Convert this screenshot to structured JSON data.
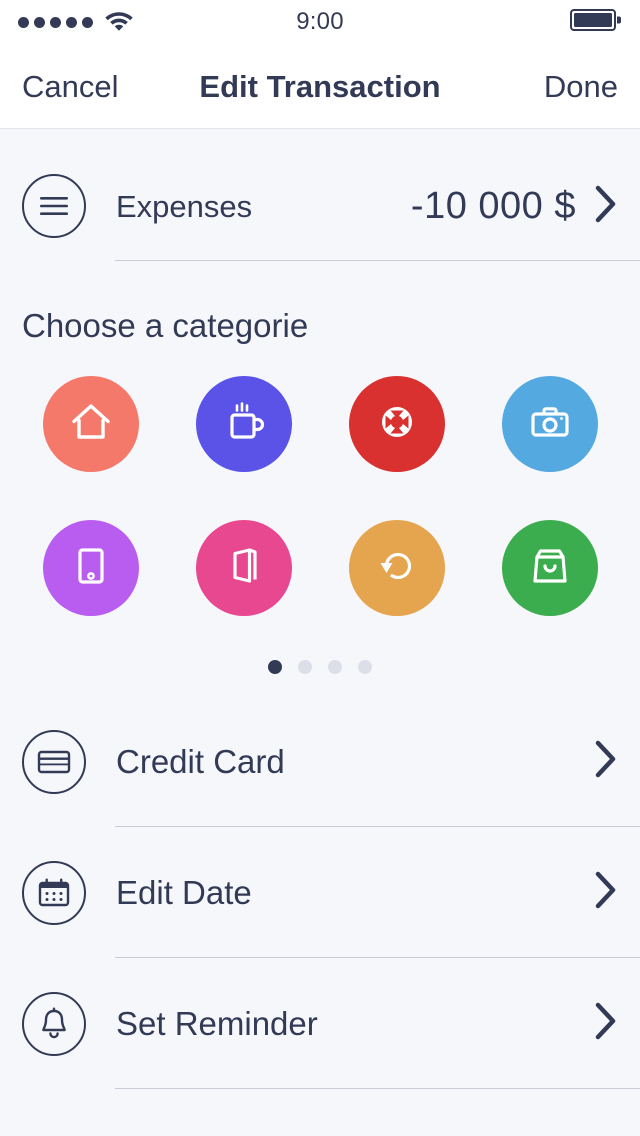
{
  "status_bar": {
    "signal_dots": 5,
    "wifi_icon": "wifi-icon",
    "time": "9:00",
    "battery_icon": "battery-full-icon"
  },
  "nav": {
    "cancel_label": "Cancel",
    "title": "Edit Transaction",
    "done_label": "Done"
  },
  "account_row": {
    "icon": "menu-lines-icon",
    "label": "Expenses",
    "amount": "-10 000 $",
    "chevron": "chevron-right-icon"
  },
  "categories": {
    "title": "Choose a categorie",
    "items": [
      {
        "name": "home",
        "icon": "home-icon",
        "color": "#f4796b"
      },
      {
        "name": "coffee",
        "icon": "coffee-mug-icon",
        "color": "#5b52e8"
      },
      {
        "name": "support",
        "icon": "lifebuoy-icon",
        "color": "#d93030"
      },
      {
        "name": "photo",
        "icon": "camera-icon",
        "color": "#54a9e0"
      },
      {
        "name": "mobile",
        "icon": "smartphone-icon",
        "color": "#b95cf0"
      },
      {
        "name": "books",
        "icon": "book-icon",
        "color": "#e8488f"
      },
      {
        "name": "recurring",
        "icon": "rotate-left-icon",
        "color": "#e5a44e"
      },
      {
        "name": "shopping",
        "icon": "shopping-bag-icon",
        "color": "#3bad4e"
      }
    ],
    "pages": 4,
    "active_page": 1
  },
  "options": [
    {
      "icon": "credit-card-icon",
      "label": "Credit Card",
      "chevron": "chevron-right-icon"
    },
    {
      "icon": "calendar-icon",
      "label": "Edit Date",
      "chevron": "chevron-right-icon"
    },
    {
      "icon": "bell-icon",
      "label": "Set Reminder",
      "chevron": "chevron-right-icon"
    }
  ],
  "colors": {
    "background": "#f6f7fb",
    "bar_background": "#ffffff",
    "text": "#333a56",
    "separator": "#c9ccd6",
    "dot_inactive": "#dcdfe8"
  }
}
